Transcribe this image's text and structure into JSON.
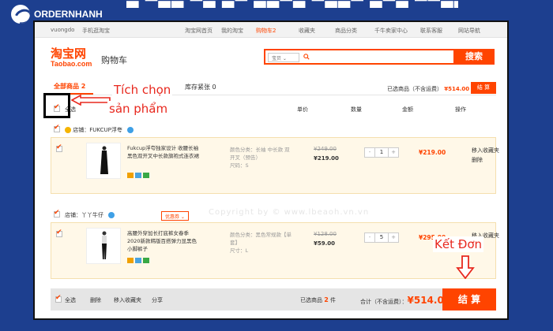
{
  "overlay": {
    "logo_text": "ORDERNHANH",
    "annotation_select": [
      "Tích chọn",
      "sản phẩm"
    ],
    "annotation_checkout": "Kết Đơn",
    "accent": "#e8281e"
  },
  "topnav": {
    "user": "vuongdo",
    "mobile": "手机逛淘宝",
    "home": "淘宝网首页",
    "my_taobao": "我的淘宝",
    "cart": "购物车2",
    "favorites": "收藏夹",
    "categories": "商品分类",
    "seller_center": "千牛卖家中心",
    "service": "联系客服",
    "site_nav": "网站导航"
  },
  "brand": {
    "logo_cn": "淘宝网",
    "logo_en": "Taobao.com",
    "page_title": "购物车",
    "accent": "#ff4400"
  },
  "search": {
    "type": "宝贝",
    "button": "搜索"
  },
  "tabs": {
    "all": "全部商品 2",
    "other": "库存紧张 0"
  },
  "summary_top": {
    "label": "已选商品（不含运费）",
    "amount": "¥514.00",
    "button": "结 算"
  },
  "columns": {
    "select_all": "全选",
    "price": "单价",
    "quantity": "数量",
    "amount": "金额",
    "actions": "操作"
  },
  "shops": [
    {
      "label": "店铺：",
      "name": "FUKCUP浮夸",
      "items": [
        {
          "title": "Fukcup浮夸独家设计 收腰长袖黑色双开叉中长款旗袍式连衣裙",
          "sku_color": "颜色分类：长袖 中长款 双开叉（预告）",
          "sku_size": "尺码：S",
          "price_old": "¥249.00",
          "price_new": "¥219.00",
          "qty": "1",
          "sum": "¥219.00",
          "op1": "移入收藏夹",
          "op2": "删除"
        }
      ]
    },
    {
      "label": "店铺：",
      "name": "丫丫牛仔",
      "coupon": "优惠券",
      "items": [
        {
          "title": "高腰外穿加长打底裤女春季2020新款韩版百搭弹力显黑色小脚裤子",
          "sku_color": "颜色分类：黑色常规款【单套】",
          "sku_size": "尺寸：L",
          "price_old": "¥128.00",
          "price_new": "¥59.00",
          "qty": "5",
          "sum": "¥295.00",
          "op1": "移入收藏夹",
          "op2": "删除"
        }
      ]
    }
  ],
  "watermark": "Copyright by © www.lbeaoh.vn.vn",
  "footer": {
    "select_all": "全选",
    "delete": "删除",
    "move_fav": "移入收藏夹",
    "share": "分享",
    "selected_label": "已选商品",
    "selected_count": "2",
    "selected_unit": "件",
    "total_label": "合计（不含运费）：",
    "total": "¥514.00",
    "settle": "结 算"
  }
}
